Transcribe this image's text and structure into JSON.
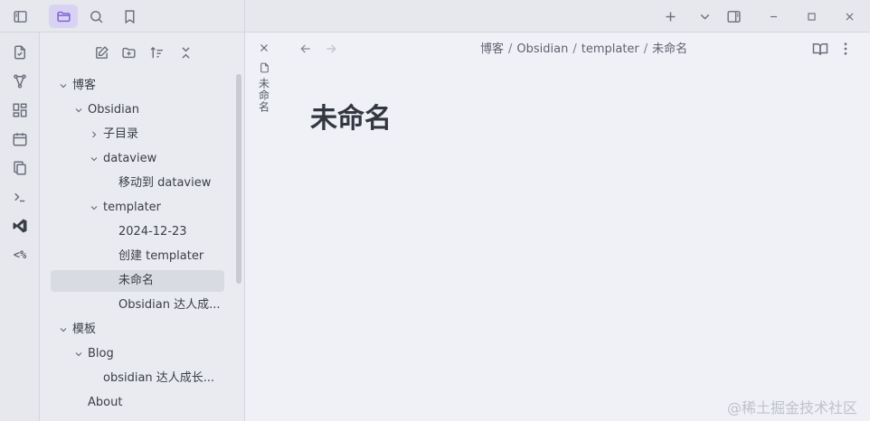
{
  "titlebar": {
    "window_controls": [
      "minimize",
      "maximize",
      "close"
    ]
  },
  "ribbon": {
    "templater_label": "<%"
  },
  "file_tree": [
    {
      "label": "博客",
      "depth": 0,
      "type": "folder",
      "expanded": true
    },
    {
      "label": "Obsidian",
      "depth": 1,
      "type": "folder",
      "expanded": true
    },
    {
      "label": "子目录",
      "depth": 2,
      "type": "folder",
      "expanded": false
    },
    {
      "label": "dataview",
      "depth": 2,
      "type": "folder",
      "expanded": true
    },
    {
      "label": "移动到 dataview",
      "depth": 3,
      "type": "file"
    },
    {
      "label": "templater",
      "depth": 2,
      "type": "folder",
      "expanded": true
    },
    {
      "label": "2024-12-23",
      "depth": 3,
      "type": "file"
    },
    {
      "label": "创建 templater",
      "depth": 3,
      "type": "file"
    },
    {
      "label": "未命名",
      "depth": 3,
      "type": "file",
      "selected": true
    },
    {
      "label": "Obsidian 达人成...",
      "depth": 3,
      "type": "file"
    },
    {
      "label": "模板",
      "depth": 0,
      "type": "folder",
      "expanded": true
    },
    {
      "label": "Blog",
      "depth": 1,
      "type": "folder",
      "expanded": true
    },
    {
      "label": "obsidian 达人成长...",
      "depth": 2,
      "type": "file"
    },
    {
      "label": "About",
      "depth": 1,
      "type": "file"
    }
  ],
  "tab": {
    "title": "未命名"
  },
  "breadcrumb": [
    "博客",
    "Obsidian",
    "templater",
    "未命名"
  ],
  "note": {
    "title": "未命名"
  },
  "watermark": "@稀土掘金技术社区",
  "colors": {
    "accent": "#7b5cd6",
    "accent_bg": "#d9d3f3",
    "vscode_icon": "#3a3e47"
  }
}
